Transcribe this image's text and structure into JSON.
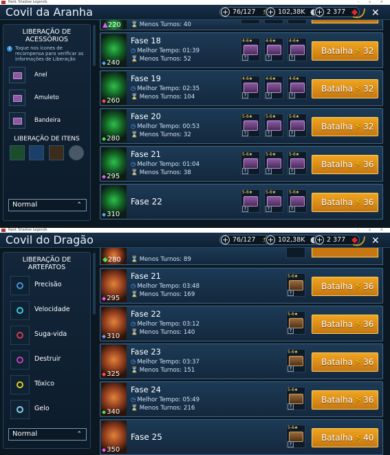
{
  "window": {
    "title": "Raid: Shadow Legends",
    "controls": "– ▫ ×"
  },
  "resources": {
    "energy": "76/127",
    "silver": "102,38K",
    "gems": "2 377",
    "plus": "+"
  },
  "icons": {
    "close": "✕",
    "caret": "⌃",
    "clock": "◷",
    "turns": "⌛",
    "info": "i",
    "question": "?",
    "bolt": "⚡",
    "gem": "◆",
    "silver": "●"
  },
  "top": {
    "title": "Covil da Aranha",
    "sidebar_title": "LIBERAÇÃO DE ACESSÓRIOS",
    "info_text": "Toque nos ícones de recompensa para verificar as informações de Liberação",
    "accessories": [
      "Anel",
      "Amuleto",
      "Bandeira"
    ],
    "items_title": "LIBERAÇÃO DE ITENS",
    "difficulty": "Normal",
    "partial_row": {
      "level": "220",
      "turns_label": "Menos Turnos: 40"
    },
    "stages": [
      {
        "name": "Fase 18",
        "level": "240",
        "mark": "blue",
        "best": "Melhor Tempo: 01:39",
        "turns": "Menos Turnos: 52",
        "stars": [
          "4-6★",
          "4-6★",
          "4-6★"
        ],
        "battle": "Batalha",
        "cost": "32"
      },
      {
        "name": "Fase 19",
        "level": "260",
        "mark": "red",
        "best": "Melhor Tempo: 02:35",
        "turns": "Menos Turnos: 104",
        "stars": [
          "4-6★",
          "4-6★",
          "4-6★"
        ],
        "battle": "Batalha",
        "cost": "32"
      },
      {
        "name": "Fase 20",
        "level": "280",
        "mark": "green",
        "best": "Melhor Tempo: 00:53",
        "turns": "Menos Turnos: 32",
        "stars": [
          "5-6★",
          "5-6★",
          "5-6★"
        ],
        "battle": "Batalha",
        "cost": "32"
      },
      {
        "name": "Fase 21",
        "level": "295",
        "mark": "pink",
        "best": "Melhor Tempo: 01:04",
        "turns": "Menos Turnos: 38",
        "stars": [
          "5-6★",
          "5-6★",
          "5-6★"
        ],
        "battle": "Batalha",
        "cost": "36"
      },
      {
        "name": "Fase 22",
        "level": "310",
        "mark": "blue",
        "best": "",
        "turns": "",
        "stars": [
          "5-6★",
          "5-6★",
          "5-6★"
        ],
        "battle": "Batalha",
        "cost": "36"
      }
    ]
  },
  "bottom": {
    "title": "Covil do Dragão",
    "sidebar_title": "LIBERAÇÃO DE ARTEFATOS",
    "artifact_sets": [
      "Precisão",
      "Velocidade",
      "Suga-vida",
      "Destruir",
      "Tóxico",
      "Gelo"
    ],
    "difficulty": "Normal",
    "partial_row": {
      "level": "280",
      "turns_label": "Menos Turnos: 89"
    },
    "stages": [
      {
        "name": "Fase 21",
        "level": "295",
        "mark": "pink",
        "best": "Melhor Tempo: 03:48",
        "turns": "Menos Turnos: 169",
        "stars": [
          "5-6★"
        ],
        "battle": "Batalha",
        "cost": "36"
      },
      {
        "name": "Fase 22",
        "level": "310",
        "mark": "blue",
        "best": "Melhor Tempo: 03:12",
        "turns": "Menos Turnos: 140",
        "stars": [
          "5-6★"
        ],
        "battle": "Batalha",
        "cost": "36"
      },
      {
        "name": "Fase 23",
        "level": "325",
        "mark": "red",
        "best": "Melhor Tempo: 03:37",
        "turns": "Menos Turnos: 151",
        "stars": [
          "5-6★"
        ],
        "battle": "Batalha",
        "cost": "36"
      },
      {
        "name": "Fase 24",
        "level": "340",
        "mark": "green",
        "best": "Melhor Tempo: 05:49",
        "turns": "Menos Turnos: 216",
        "stars": [
          "5-6★"
        ],
        "battle": "Batalha",
        "cost": "36"
      },
      {
        "name": "Fase 25",
        "level": "350",
        "mark": "pink",
        "best": "",
        "turns": "",
        "stars": [
          "5-6★"
        ],
        "battle": "Batalha",
        "cost": "40"
      }
    ]
  }
}
